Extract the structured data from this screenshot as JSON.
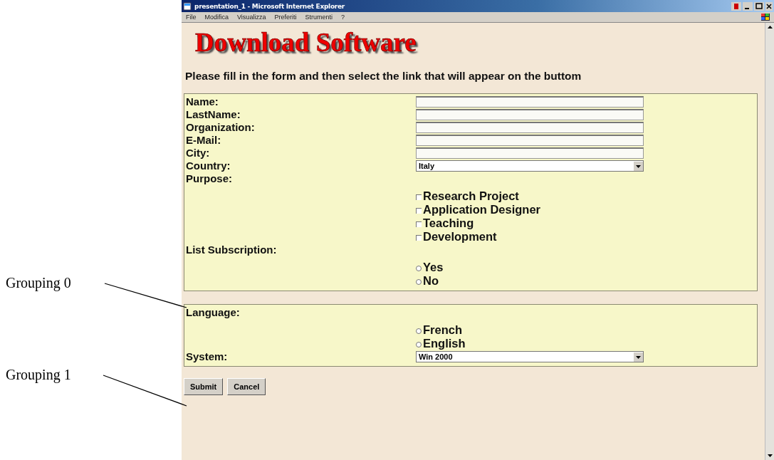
{
  "annotations": [
    {
      "label": "Grouping 0"
    },
    {
      "label": "Grouping 1"
    }
  ],
  "window": {
    "title": "presentation_1 - Microsoft Internet Explorer"
  },
  "menu": [
    "File",
    "Modifica",
    "Visualizza",
    "Preferiti",
    "Strumenti",
    "?"
  ],
  "heading": "Download Software",
  "instruction": "Please fill in the form and then select the link that will appear on the buttom",
  "groups": [
    {
      "fields": [
        {
          "kind": "text",
          "label": "Name:"
        },
        {
          "kind": "text",
          "label": "LastName:"
        },
        {
          "kind": "text",
          "label": "Organization:"
        },
        {
          "kind": "text",
          "label": "E-Mail:"
        },
        {
          "kind": "text",
          "label": "City:"
        },
        {
          "kind": "select",
          "label": "Country:",
          "value": "Italy"
        },
        {
          "kind": "checkboxes",
          "label": "Purpose:",
          "options": [
            {
              "label": "Research Project",
              "checked": false
            },
            {
              "label": "Application Designer",
              "checked": false
            },
            {
              "label": "Teaching",
              "checked": false
            },
            {
              "label": "Development",
              "checked": false
            }
          ]
        },
        {
          "kind": "radios",
          "label": "List Subscription:",
          "options": [
            {
              "label": "Yes",
              "selected": false
            },
            {
              "label": "No",
              "selected": false
            }
          ]
        }
      ]
    },
    {
      "fields": [
        {
          "kind": "radios",
          "label": "Language:",
          "options": [
            {
              "label": "French",
              "selected": false
            },
            {
              "label": "English",
              "selected": false
            }
          ]
        },
        {
          "kind": "select",
          "label": "System:",
          "value": "Win 2000"
        }
      ]
    }
  ],
  "buttons": [
    "Submit",
    "Cancel"
  ]
}
